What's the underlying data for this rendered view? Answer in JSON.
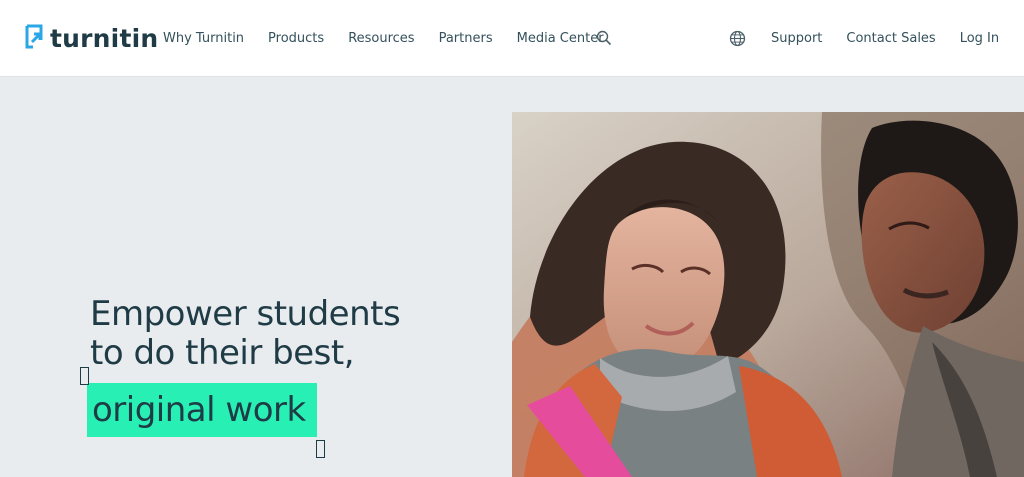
{
  "header": {
    "brand": "turnitin",
    "nav": [
      "Why Turnitin",
      "Products",
      "Resources",
      "Partners",
      "Media Center"
    ],
    "right_nav": [
      "Support",
      "Contact Sales",
      "Log In"
    ]
  },
  "hero": {
    "headline_line1": "Empower students",
    "headline_line2": "to do their best,",
    "highlight": "original work"
  },
  "colors": {
    "accent": "#28f0b4",
    "brand_blue": "#2aa7e6",
    "background": "#e8ecef"
  },
  "icons": {
    "search": "search-icon",
    "globe": "globe-icon",
    "logo": "turnitin-logo-icon"
  }
}
